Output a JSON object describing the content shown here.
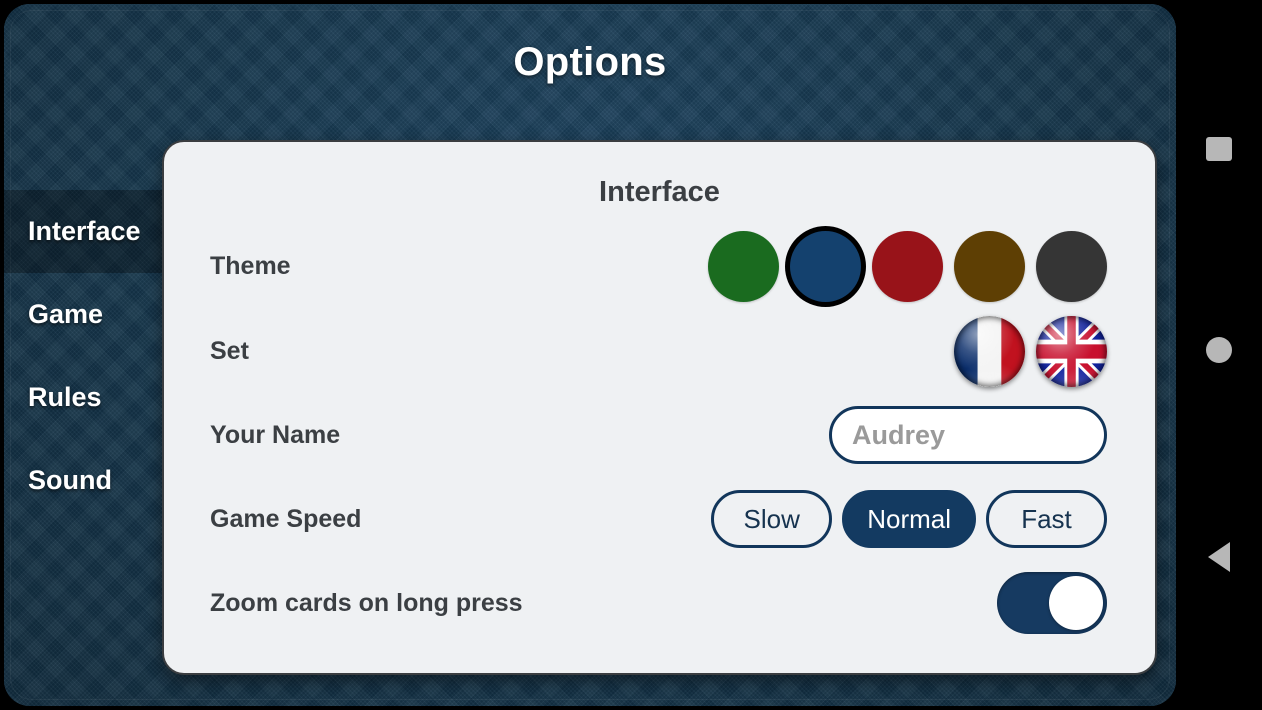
{
  "window": {
    "title": "Options"
  },
  "sidebar": {
    "items": [
      {
        "label": "Interface",
        "selected": true
      },
      {
        "label": "Game",
        "selected": false
      },
      {
        "label": "Rules",
        "selected": false
      },
      {
        "label": "Sound",
        "selected": false
      }
    ]
  },
  "panel": {
    "heading": "Interface",
    "rows": {
      "theme": {
        "label": "Theme",
        "swatches": [
          {
            "name": "green",
            "color": "#1a6b1f",
            "selected": false
          },
          {
            "name": "blue",
            "color": "#14416e",
            "selected": true
          },
          {
            "name": "red",
            "color": "#981319",
            "selected": false
          },
          {
            "name": "brown",
            "color": "#5e3f04",
            "selected": false
          },
          {
            "name": "gray",
            "color": "#353535",
            "selected": false
          }
        ]
      },
      "set": {
        "label": "Set",
        "options": [
          {
            "name": "french-flag",
            "title": "French",
            "selected": false
          },
          {
            "name": "uk-flag",
            "title": "English",
            "selected": true
          }
        ]
      },
      "name": {
        "label": "Your Name",
        "value": "",
        "placeholder": "Audrey"
      },
      "speed": {
        "label": "Game Speed",
        "options": [
          {
            "label": "Slow",
            "selected": false
          },
          {
            "label": "Normal",
            "selected": true
          },
          {
            "label": "Fast",
            "selected": false
          }
        ]
      },
      "zoom": {
        "label": "Zoom cards on long press",
        "enabled": true
      }
    }
  },
  "navbar": {
    "recents": "recents-square-icon",
    "home": "home-circle-icon",
    "back": "back-triangle-icon"
  },
  "colors": {
    "accent": "#133a61",
    "frame": "#173a52",
    "card": "#eff1f3",
    "label": "#3b3f43"
  }
}
